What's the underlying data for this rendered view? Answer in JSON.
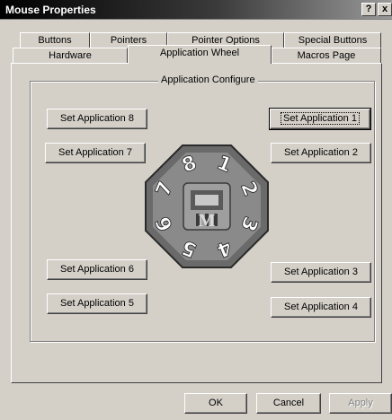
{
  "window": {
    "title": "Mouse Properties",
    "help_glyph": "?",
    "close_glyph": "x"
  },
  "tabs_back": [
    "Buttons",
    "Pointers",
    "Pointer Options",
    "Special Buttons"
  ],
  "tabs_front": [
    "Hardware",
    "Application Wheel",
    "Macros Page"
  ],
  "active_tab": "Application Wheel",
  "group": {
    "title": "Application Configure"
  },
  "buttons": {
    "app1": "Set Application 1",
    "app2": "Set Application 2",
    "app3": "Set Application 3",
    "app4": "Set Application 4",
    "app5": "Set Application 5",
    "app6": "Set Application 6",
    "app7": "Set Application 7",
    "app8": "Set Application 8"
  },
  "wheel": {
    "numbers": [
      "1",
      "2",
      "3",
      "4",
      "5",
      "6",
      "7",
      "8"
    ],
    "logo_text": "M"
  },
  "footer": {
    "ok": "OK",
    "cancel": "Cancel",
    "apply": "Apply"
  }
}
